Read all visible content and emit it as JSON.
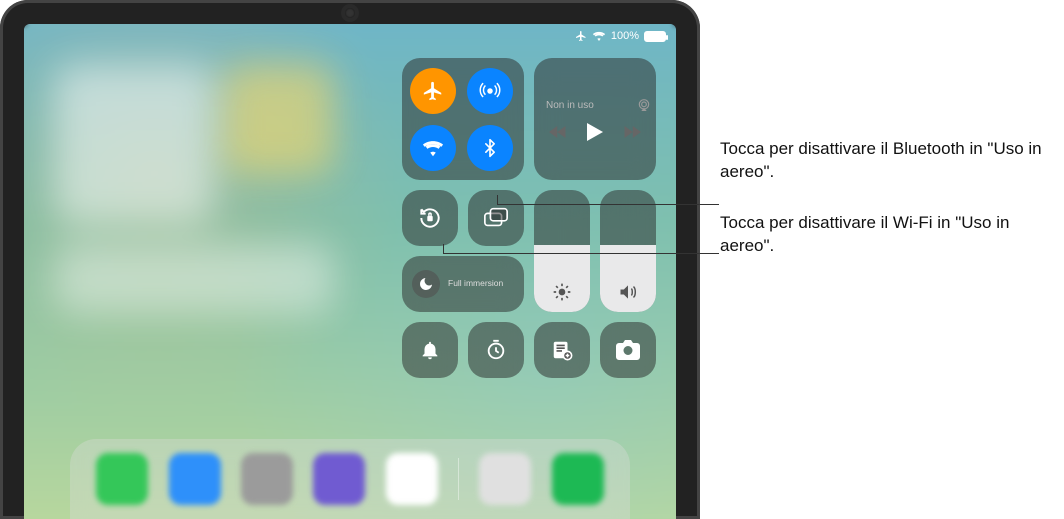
{
  "status_bar": {
    "airplane_icon": "airplane",
    "wifi_icon": "wifi",
    "battery_percent": "100%"
  },
  "connectivity": {
    "airplane_mode": {
      "active": true,
      "color": "#ff9500"
    },
    "airdrop": {
      "active": true,
      "color": "#0a84ff"
    },
    "wifi": {
      "active": true,
      "color": "#0a84ff"
    },
    "bluetooth": {
      "active": true,
      "color": "#0a84ff"
    }
  },
  "media": {
    "status_label": "Non in uso",
    "airplay_icon": "airplay"
  },
  "focus": {
    "label": "Full immersion"
  },
  "sliders": {
    "brightness_percent": 55,
    "volume_percent": 55
  },
  "bottom_buttons": {
    "silent": "bell",
    "timer": "timer",
    "quick_note": "quick-note",
    "camera": "camera"
  },
  "rotation_lock": "rotation-lock",
  "screen_mirroring": "screen-mirroring",
  "callouts": {
    "bluetooth": "Tocca per disattivare il Bluetooth in \"Uso in aereo\".",
    "wifi": "Tocca per disattivare il Wi-Fi in \"Uso in aereo\"."
  },
  "dock_colors": [
    "#34c759",
    "#2e90fa",
    "#9b9b9b",
    "#705bd1",
    "#fff",
    "#e0e0e0",
    "#1db954"
  ]
}
